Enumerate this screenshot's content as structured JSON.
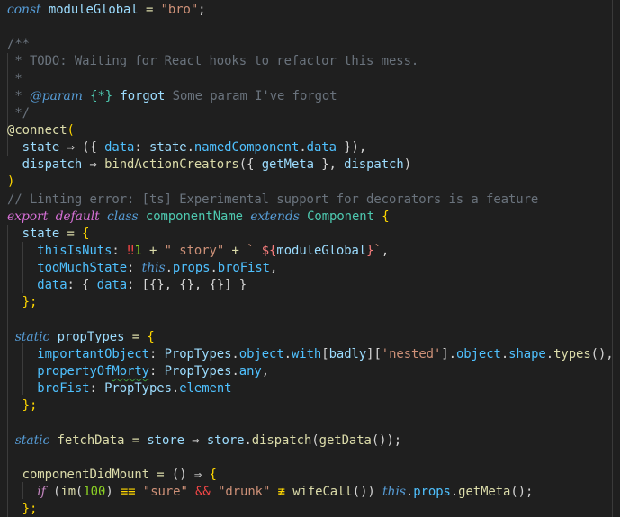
{
  "editor": {
    "language": "javascript",
    "lines": [
      {
        "tokens": [
          [
            "kw-it",
            "const"
          ],
          [
            "var",
            " moduleGlobal "
          ],
          [
            "op-y",
            "="
          ],
          [
            "str",
            " \"bro\""
          ],
          [
            "punc",
            ";"
          ]
        ]
      },
      {
        "tokens": []
      },
      {
        "tokens": [
          [
            "cmt",
            "/**"
          ]
        ]
      },
      {
        "tokens": [
          [
            "cmt",
            " * TODO: Waiting for React hooks to refactor this mess."
          ]
        ]
      },
      {
        "tokens": [
          [
            "cmt",
            " *"
          ]
        ]
      },
      {
        "tokens": [
          [
            "cmt",
            " * "
          ],
          [
            "cmt-tag",
            "@param"
          ],
          [
            "cmt",
            " "
          ],
          [
            "cmt-type",
            "{*}"
          ],
          [
            "cmt",
            " "
          ],
          [
            "cmt-name",
            "forgot"
          ],
          [
            "cmt",
            " Some param I've forgot"
          ]
        ]
      },
      {
        "tokens": [
          [
            "cmt",
            " */"
          ]
        ]
      },
      {
        "tokens": [
          [
            "dec",
            "@connect"
          ],
          [
            "brace",
            "("
          ]
        ]
      },
      {
        "tokens": [
          [
            "var",
            "  state "
          ],
          [
            "op",
            "⇒"
          ],
          [
            "punc",
            " ({ "
          ],
          [
            "prop",
            "data"
          ],
          [
            "punc",
            ": "
          ],
          [
            "var",
            "state"
          ],
          [
            "punc",
            "."
          ],
          [
            "prop",
            "namedComponent"
          ],
          [
            "punc",
            "."
          ],
          [
            "prop",
            "data"
          ],
          [
            "punc",
            " }),"
          ]
        ]
      },
      {
        "tokens": [
          [
            "var",
            "  dispatch "
          ],
          [
            "op",
            "⇒"
          ],
          [
            "punc",
            " "
          ],
          [
            "fn",
            "bindActionCreators"
          ],
          [
            "punc",
            "({ "
          ],
          [
            "var",
            "getMeta"
          ],
          [
            "punc",
            " }, "
          ],
          [
            "var",
            "dispatch"
          ],
          [
            "punc",
            ")"
          ]
        ]
      },
      {
        "tokens": [
          [
            "brace",
            ")"
          ]
        ]
      },
      {
        "tokens": [
          [
            "cmt",
            "// Linting error: [ts] Experimental support for decorators is a feature"
          ]
        ]
      },
      {
        "tokens": [
          [
            "kw-pink",
            "export"
          ],
          [
            "punc",
            " "
          ],
          [
            "kw-pink",
            "default"
          ],
          [
            "punc",
            " "
          ],
          [
            "kw-it",
            "class"
          ],
          [
            "punc",
            " "
          ],
          [
            "cls",
            "componentName"
          ],
          [
            "punc",
            " "
          ],
          [
            "kw-it",
            "extends"
          ],
          [
            "punc",
            " "
          ],
          [
            "cls",
            "Component"
          ],
          [
            "brace",
            " {"
          ]
        ]
      },
      {
        "tokens": [
          [
            "var",
            "  state "
          ],
          [
            "op-y",
            "="
          ],
          [
            "brace",
            " {"
          ]
        ]
      },
      {
        "tokens": [
          [
            "prop",
            "    thisIsNuts"
          ],
          [
            "punc",
            ": "
          ],
          [
            "bang",
            "‼"
          ],
          [
            "num-g",
            "1"
          ],
          [
            "op-y",
            " +"
          ],
          [
            "str",
            " \" story\""
          ],
          [
            "op-y",
            " +"
          ],
          [
            "str",
            " ` "
          ],
          [
            "tmpl",
            "${"
          ],
          [
            "var",
            "moduleGlobal"
          ],
          [
            "tmpl",
            "}"
          ],
          [
            "str",
            "`"
          ],
          [
            "punc",
            ","
          ]
        ]
      },
      {
        "tokens": [
          [
            "prop",
            "    tooMuchState"
          ],
          [
            "punc",
            ": "
          ],
          [
            "kw-it",
            "this"
          ],
          [
            "punc",
            "."
          ],
          [
            "prop",
            "props"
          ],
          [
            "punc",
            "."
          ],
          [
            "prop",
            "broFist"
          ],
          [
            "punc",
            ","
          ]
        ]
      },
      {
        "tokens": [
          [
            "prop",
            "    data"
          ],
          [
            "punc",
            ": { "
          ],
          [
            "prop",
            "data"
          ],
          [
            "punc",
            ": [{}, {}, {}] }"
          ]
        ]
      },
      {
        "tokens": [
          [
            "brace",
            "  };"
          ]
        ]
      },
      {
        "tokens": []
      },
      {
        "tokens": [
          [
            "kw-it",
            "  static"
          ],
          [
            "punc",
            " "
          ],
          [
            "var",
            "propTypes "
          ],
          [
            "op-y",
            "="
          ],
          [
            "brace",
            " {"
          ]
        ]
      },
      {
        "tokens": [
          [
            "prop",
            "    importantObject"
          ],
          [
            "punc",
            ": "
          ],
          [
            "var",
            "PropTypes"
          ],
          [
            "punc",
            "."
          ],
          [
            "prop",
            "object"
          ],
          [
            "punc",
            "."
          ],
          [
            "prop",
            "with"
          ],
          [
            "punc",
            "["
          ],
          [
            "var",
            "badly"
          ],
          [
            "punc",
            "]["
          ],
          [
            "str",
            "'nested'"
          ],
          [
            "punc",
            "]."
          ],
          [
            "prop",
            "object"
          ],
          [
            "punc",
            "."
          ],
          [
            "prop",
            "shape"
          ],
          [
            "punc",
            "."
          ],
          [
            "fn",
            "types"
          ],
          [
            "punc",
            "(),"
          ]
        ]
      },
      {
        "tokens": [
          [
            "prop",
            "    propertyOf"
          ],
          [
            "prop squiggle",
            "Morty"
          ],
          [
            "punc",
            ": "
          ],
          [
            "var",
            "PropTypes"
          ],
          [
            "punc",
            "."
          ],
          [
            "prop",
            "any"
          ],
          [
            "punc",
            ","
          ]
        ]
      },
      {
        "tokens": [
          [
            "prop",
            "    broFist"
          ],
          [
            "punc",
            ": "
          ],
          [
            "var",
            "PropTypes"
          ],
          [
            "punc",
            "."
          ],
          [
            "prop",
            "element"
          ]
        ]
      },
      {
        "tokens": [
          [
            "brace",
            "  };"
          ]
        ]
      },
      {
        "tokens": []
      },
      {
        "tokens": [
          [
            "kw-it",
            "  static"
          ],
          [
            "punc",
            " "
          ],
          [
            "fn",
            "fetchData "
          ],
          [
            "op-y",
            "="
          ],
          [
            "var",
            " store "
          ],
          [
            "op",
            "⇒"
          ],
          [
            "var",
            " store"
          ],
          [
            "punc",
            "."
          ],
          [
            "fn",
            "dispatch"
          ],
          [
            "punc",
            "("
          ],
          [
            "fn",
            "getData"
          ],
          [
            "punc",
            "());"
          ]
        ]
      },
      {
        "tokens": []
      },
      {
        "tokens": [
          [
            "fn",
            "  componentDidMount "
          ],
          [
            "op-y",
            "="
          ],
          [
            "punc",
            " () "
          ],
          [
            "op",
            "⇒"
          ],
          [
            "brace",
            " {"
          ]
        ]
      },
      {
        "tokens": [
          [
            "punc",
            "    "
          ],
          [
            "kw-ctrl",
            "if"
          ],
          [
            "punc",
            " ("
          ],
          [
            "fn",
            "im"
          ],
          [
            "punc",
            "("
          ],
          [
            "num-g",
            "100"
          ],
          [
            "punc",
            ") "
          ],
          [
            "eqq",
            "≡≡"
          ],
          [
            "str",
            " \"sure\" "
          ],
          [
            "amp",
            "&&"
          ],
          [
            "str",
            " \"drunk\" "
          ],
          [
            "eqq",
            "≢"
          ],
          [
            "punc",
            " "
          ],
          [
            "fn",
            "wifeCall"
          ],
          [
            "punc",
            "()) "
          ],
          [
            "kw-it",
            "this"
          ],
          [
            "punc",
            "."
          ],
          [
            "prop",
            "props"
          ],
          [
            "punc",
            "."
          ],
          [
            "fn",
            "getMeta"
          ],
          [
            "punc",
            "();"
          ]
        ]
      },
      {
        "tokens": [
          [
            "brace",
            "  };"
          ]
        ]
      }
    ]
  }
}
